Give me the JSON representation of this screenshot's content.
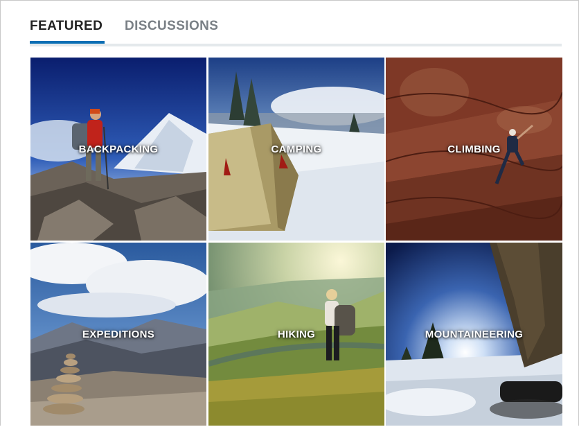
{
  "tabs": [
    {
      "label": "FEATURED",
      "active": true
    },
    {
      "label": "DISCUSSIONS",
      "active": false
    }
  ],
  "colors": {
    "accent": "#0a6eb4",
    "tab_active": "#222222",
    "tab_inactive": "#7a8086"
  },
  "tiles": [
    {
      "label": "BACKPACKING"
    },
    {
      "label": "CAMPING"
    },
    {
      "label": "CLIMBING"
    },
    {
      "label": "EXPEDITIONS"
    },
    {
      "label": "HIKING"
    },
    {
      "label": "MOUNTAINEERING"
    }
  ]
}
